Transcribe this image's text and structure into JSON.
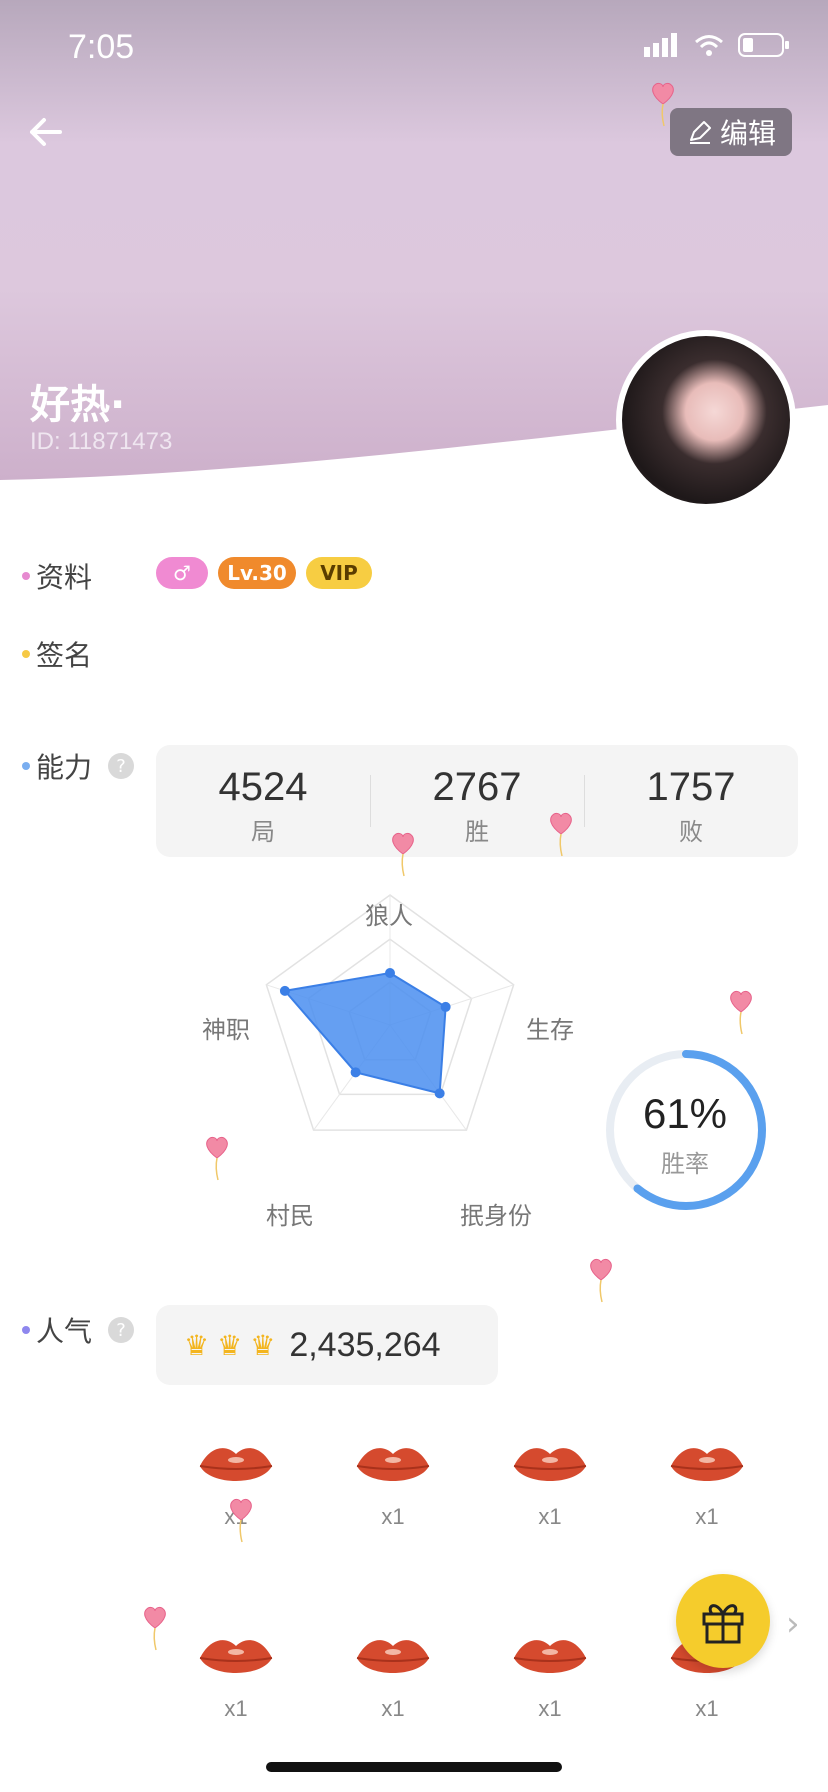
{
  "status_bar": {
    "time": "7:05"
  },
  "header": {
    "edit_label": "编辑",
    "username": "好热·",
    "user_id": "ID: 11871473"
  },
  "profile": {
    "label": "资料",
    "badges": [
      {
        "text": "♂",
        "color": "#f08ad2"
      },
      {
        "text": "Lv.30",
        "color": "#f08a2c"
      },
      {
        "text": "VIP",
        "color": "#f7cd42"
      }
    ]
  },
  "signature": {
    "label": "签名"
  },
  "ability": {
    "label": "能力",
    "help": "?",
    "stats": [
      {
        "value": "4524",
        "label": "局"
      },
      {
        "value": "2767",
        "label": "胜"
      },
      {
        "value": "1757",
        "label": "败"
      }
    ],
    "radar_axes": [
      "狼人",
      "生存",
      "抿身份",
      "村民",
      "神职"
    ],
    "radar_values": [
      0.4,
      0.45,
      0.65,
      0.45,
      0.85
    ],
    "win_rate": {
      "value": "61%",
      "label": "胜率",
      "fraction": 0.61
    }
  },
  "popularity": {
    "label": "人气",
    "help": "?",
    "crowns": 3,
    "value": "2,435,264"
  },
  "gifts": [
    {
      "qty": "x1"
    },
    {
      "qty": "x1"
    },
    {
      "qty": "x1"
    },
    {
      "qty": "x1"
    },
    {
      "qty": "x1"
    },
    {
      "qty": "x1"
    },
    {
      "qty": "x1"
    },
    {
      "qty": "x1"
    }
  ],
  "colors": {
    "profile_dot": "#e68ad0",
    "signature_dot": "#f6c945",
    "ability_dot": "#7aaef0",
    "popularity_dot": "#8e87ee",
    "radar_fill": "#4a8ef0",
    "win_ring": "#5aa0ee"
  }
}
